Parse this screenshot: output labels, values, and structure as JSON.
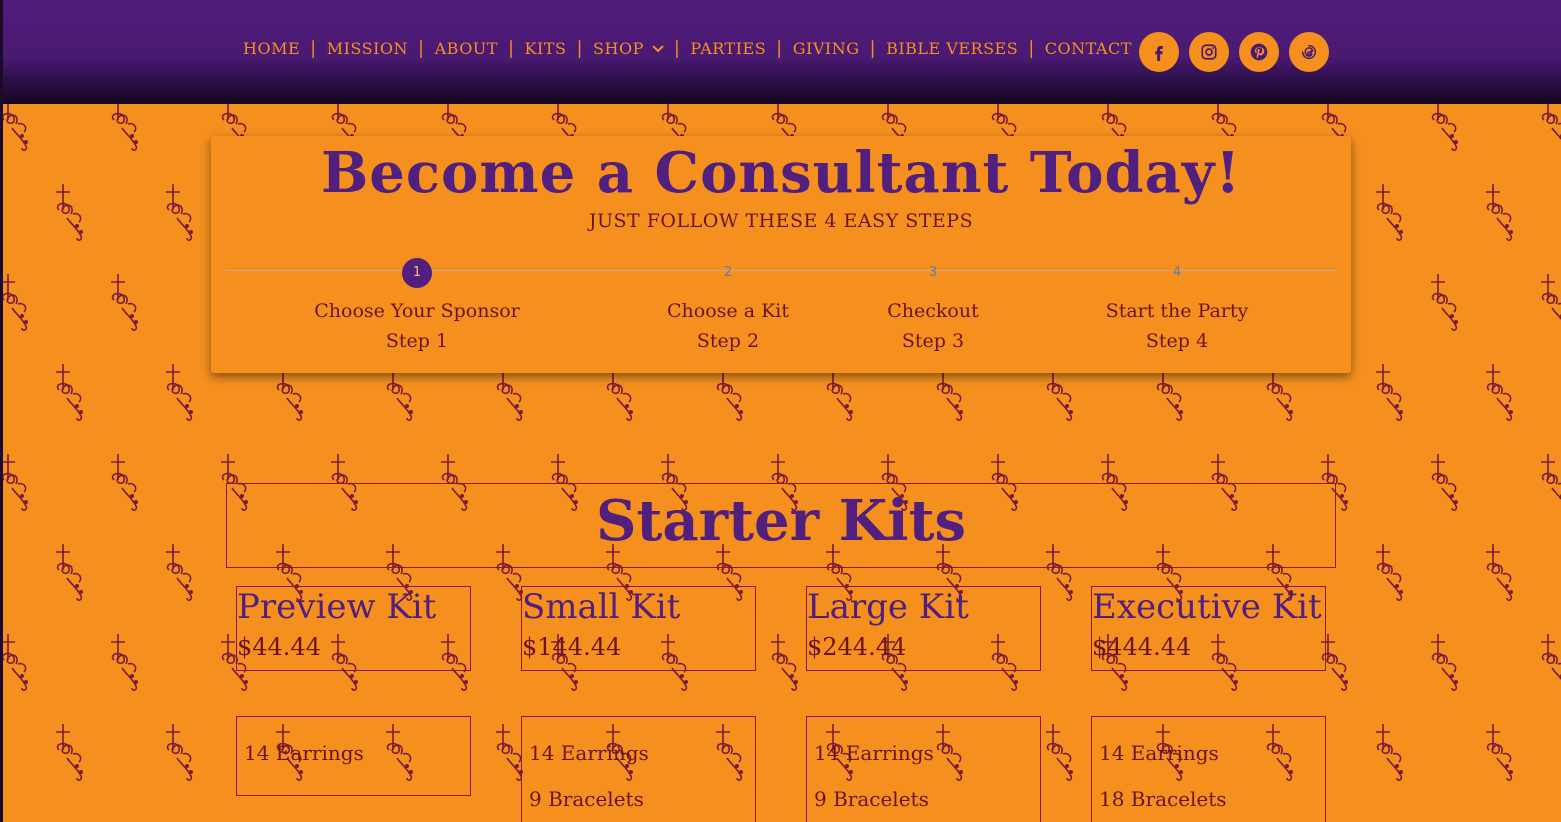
{
  "nav": {
    "items": [
      {
        "label": "HOME"
      },
      {
        "label": "MISSION"
      },
      {
        "label": "ABOUT"
      },
      {
        "label": "KITS"
      },
      {
        "label": "SHOP"
      },
      {
        "label": "PARTIES"
      },
      {
        "label": "GIVING"
      },
      {
        "label": "BIBLE VERSES"
      },
      {
        "label": "CONTACT"
      }
    ],
    "separator": "|",
    "social": [
      "facebook-icon",
      "instagram-icon",
      "pinterest-icon",
      "threads-icon"
    ]
  },
  "colors": {
    "brand_purple": "#511f7d",
    "brand_orange": "#f5901f",
    "text_maroon": "#6a1420"
  },
  "consultant": {
    "title": "Become a Consultant Today!",
    "subtitle": "JUST FOLLOW THESE 4 EASY STEPS",
    "active_step": 1,
    "steps": [
      {
        "number": "1",
        "label": "Choose Your Sponsor",
        "step": "Step 1"
      },
      {
        "number": "2",
        "label": "Choose a Kit",
        "step": "Step 2"
      },
      {
        "number": "3",
        "label": "Checkout",
        "step": "Step 3"
      },
      {
        "number": "4",
        "label": "Start the Party",
        "step": "Step 4"
      }
    ]
  },
  "kits": {
    "title": "Starter Kits",
    "items": [
      {
        "name": "Preview Kit",
        "price": "$44.44",
        "contents": [
          "14 Earrings"
        ]
      },
      {
        "name": "Small Kit",
        "price": "$144.44",
        "contents": [
          "14 Earrings",
          "9 Bracelets"
        ]
      },
      {
        "name": "Large Kit",
        "price": "$244.44",
        "contents": [
          "14 Earrings",
          "9 Bracelets"
        ]
      },
      {
        "name": "Executive Kit",
        "price": "$444.44",
        "contents": [
          "14 Earrings",
          "18 Bracelets"
        ]
      }
    ]
  }
}
